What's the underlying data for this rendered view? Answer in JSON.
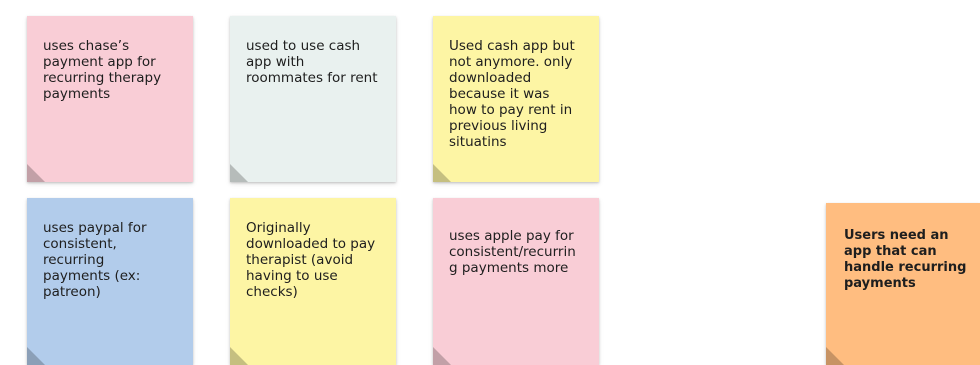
{
  "board": {
    "notes": [
      {
        "text": "uses chase’s payment app for recurring therapy payments",
        "color": "#f9cdd6"
      },
      {
        "text": "used to use cash app with roommates for rent",
        "color": "#e9f1ef"
      },
      {
        "text": "Used cash app but not anymore. only downloaded because it was how to pay rent in previous living situatins",
        "color": "#fdf5a4"
      },
      {
        "text": "uses paypal for consistent, recurring payments (ex: patreon)",
        "color": "#b2cceb"
      },
      {
        "text": "Originally downloaded to pay therapist (avoid having to use checks)",
        "color": "#fdf5a4"
      },
      {
        "text": "uses apple pay for consistent/recurring payments more",
        "color": "#f9cdd6"
      },
      {
        "text": "Users need an app that can handle recurring payments",
        "color": "#ffbd80"
      }
    ]
  },
  "colors": {
    "pink": "#f9cdd6",
    "mint": "#e9f1ef",
    "yellow": "#fdf5a4",
    "blue": "#b2cceb",
    "orange": "#ffbd80",
    "fold_shade": "rgba(0,0,0,0.22)"
  }
}
